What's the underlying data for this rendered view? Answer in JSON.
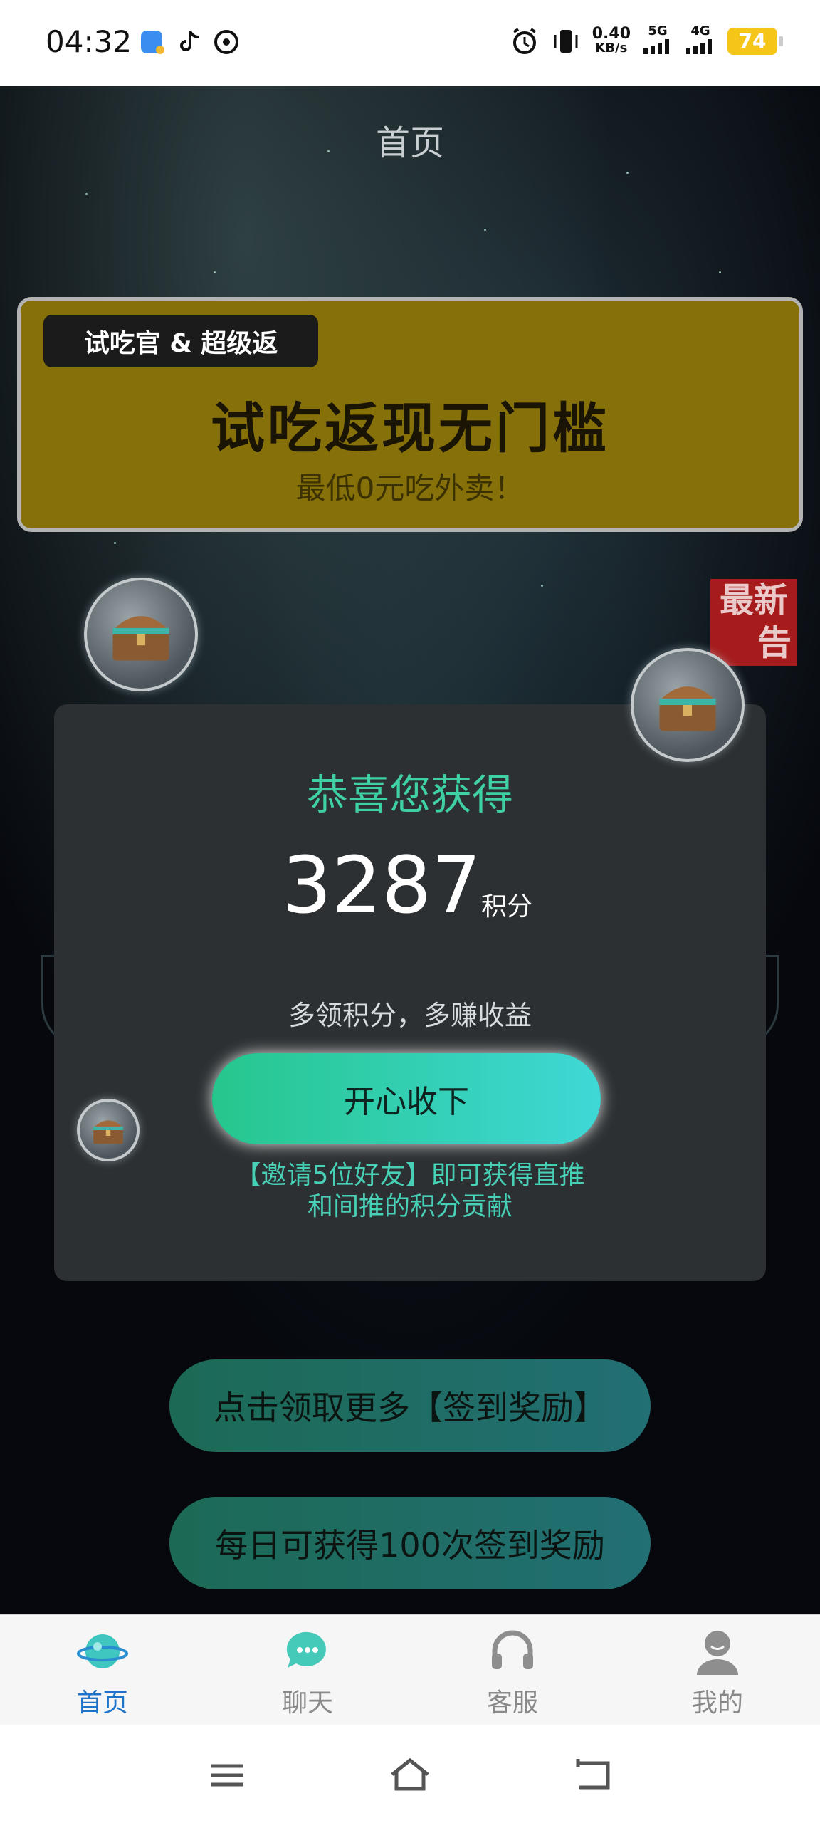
{
  "status_bar": {
    "time": "04:32",
    "net_speed": "0.40",
    "net_unit": "KB/s",
    "sim1": "5G",
    "sim2": "4G",
    "battery": "74",
    "icons": [
      "app-icon",
      "tiktok-icon",
      "sync-icon",
      "alarm-icon",
      "vibrate-icon",
      "signal-icon",
      "battery-icon"
    ]
  },
  "header": {
    "title": "首页"
  },
  "banner": {
    "tag": "试吃官 & 超级返",
    "title": "试吃返现无门槛",
    "subtitle": "最低0元吃外卖！",
    "color": "#85700a"
  },
  "news_tag": {
    "line1": "最新",
    "line2": "告"
  },
  "dialog": {
    "title": "恭喜您获得",
    "amount": "3287",
    "unit": "积分",
    "desc": "多领积分，多赚收益",
    "button": "开心收下",
    "note_line1": "【邀请5位好友】即可获得直推",
    "note_line2": "和间推的积分贡献",
    "accent": "#3fd0a4"
  },
  "actions": {
    "more_rewards": "点击领取更多【签到奖励】",
    "daily_limit": "每日可获得100次签到奖励"
  },
  "tabs": [
    {
      "label": "首页",
      "icon": "planet-icon",
      "active": true
    },
    {
      "label": "聊天",
      "icon": "chat-bubble-icon",
      "active": false
    },
    {
      "label": "客服",
      "icon": "headset-icon",
      "active": false
    },
    {
      "label": "我的",
      "icon": "user-icon",
      "active": false
    }
  ],
  "nav": {
    "icons": [
      "menu-icon",
      "home-icon",
      "back-icon"
    ]
  }
}
